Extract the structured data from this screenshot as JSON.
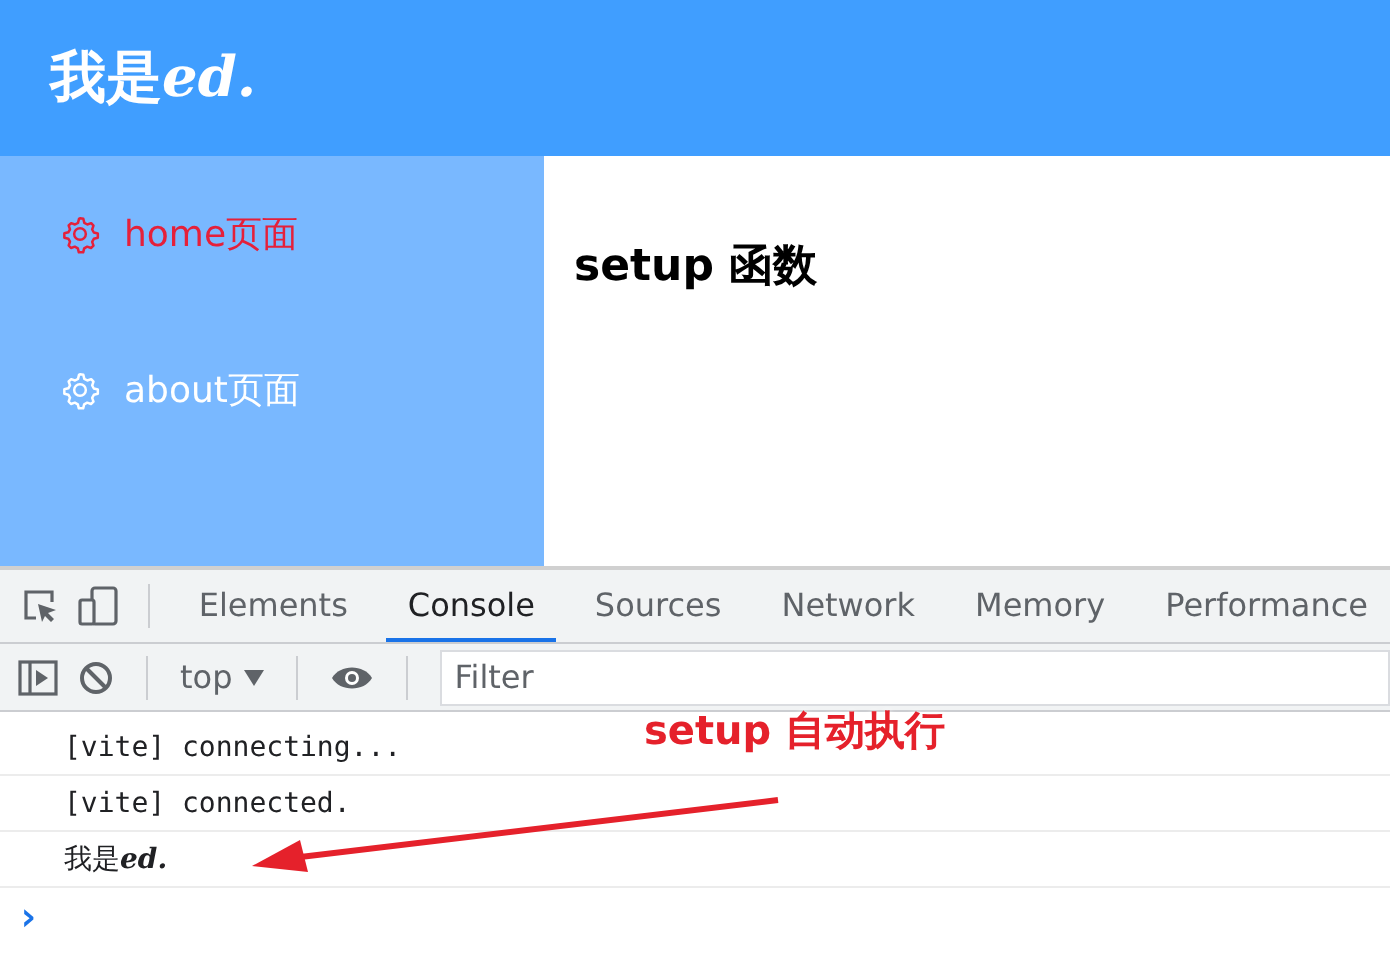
{
  "header": {
    "title": "我是",
    "title_emphasis": "ed."
  },
  "sidebar": {
    "items": [
      {
        "label": "home页面",
        "selected": true
      },
      {
        "label": "about页面",
        "selected": false
      }
    ]
  },
  "main": {
    "heading": "setup 函数"
  },
  "devtools": {
    "tabs": [
      {
        "label": "Elements",
        "selected": false
      },
      {
        "label": "Console",
        "selected": true
      },
      {
        "label": "Sources",
        "selected": false
      },
      {
        "label": "Network",
        "selected": false
      },
      {
        "label": "Memory",
        "selected": false
      },
      {
        "label": "Performance",
        "selected": false
      }
    ],
    "context": "top",
    "filter_placeholder": "Filter",
    "console_lines": [
      {
        "text": "[vite] connecting..."
      },
      {
        "text": "[vite] connected."
      },
      {
        "text": "我是",
        "emphasis": "ed."
      }
    ],
    "prompt": "›"
  },
  "annotation": {
    "text": "setup  自动执行"
  }
}
